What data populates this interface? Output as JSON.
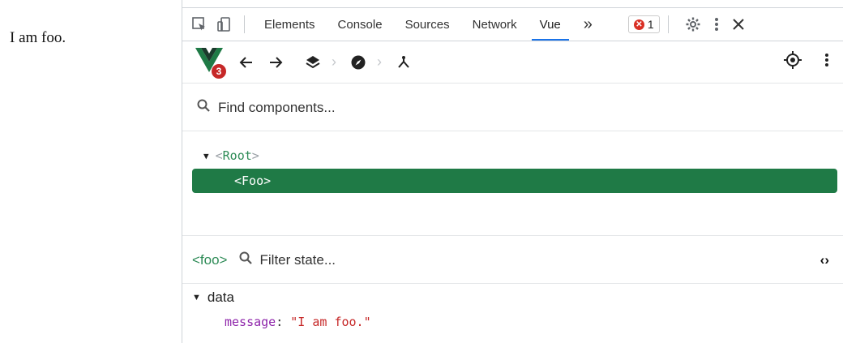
{
  "page": {
    "text": "I am foo."
  },
  "tabs": [
    {
      "label": "Elements"
    },
    {
      "label": "Console"
    },
    {
      "label": "Sources"
    },
    {
      "label": "Network"
    },
    {
      "label": "Vue"
    }
  ],
  "error_count": "1",
  "vue_version_badge": "3",
  "find": {
    "label": "Find components..."
  },
  "tree": {
    "root_lt": "<",
    "root": "Root",
    "root_gt": ">",
    "selected": "<Foo>"
  },
  "state": {
    "component_tag": "<foo>",
    "filter_label": "Filter state...",
    "section": "data",
    "key": "message",
    "value": "\"I am foo.\""
  },
  "colors": {
    "accent": "#1a73e8",
    "vue_green": "#1f7a46",
    "error": "#d93025"
  }
}
